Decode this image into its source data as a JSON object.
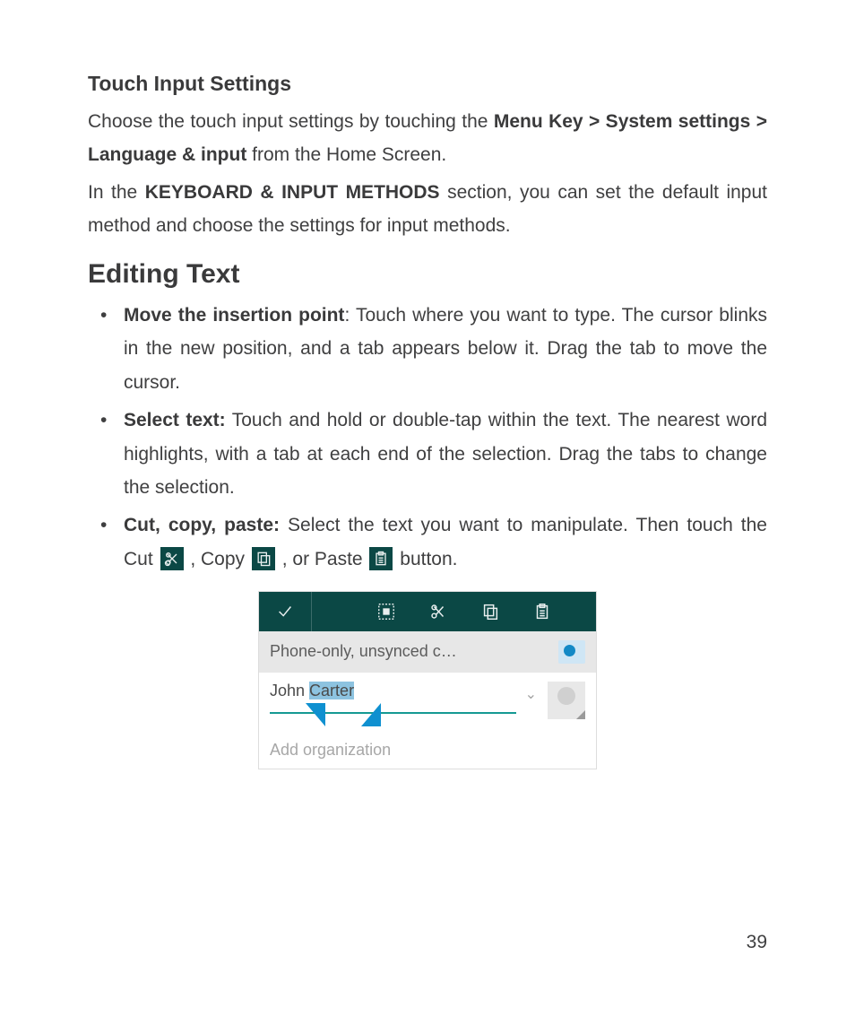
{
  "section1": {
    "heading": "Touch Input Settings",
    "p1a": "Choose the touch input settings by touching the ",
    "p1b": "Menu Key > System settings > Language & input",
    "p1c": " from the Home Screen.",
    "p2a": "In the ",
    "p2b": "KEYBOARD & INPUT METHODS",
    "p2c": " section, you can set the default input method and choose the settings for input meth­ods."
  },
  "section2": {
    "heading": "Editing Text",
    "b1_label": "Move the insertion point",
    "b1_text": ": Touch where you want to type. The cursor blinks in the new position, and a tab appears be­low it. Drag the tab to move the cursor.",
    "b2_label": "Select text:",
    "b2_text": " Touch and hold or double-tap within the text. The nearest word highlights, with a tab at each end of the selec­tion. Drag the tabs to change the selection.",
    "b3_label": "Cut, copy, paste:",
    "b3_text_a": " Select the text you want to manipulate. Then touch the Cut ",
    "b3_text_b": " , Copy ",
    "b3_text_c": " , or Paste ",
    "b3_text_d": " button."
  },
  "screenshot": {
    "row2_label": "Phone-only, unsynced c…",
    "name_pre": "John ",
    "name_selected": "Carter",
    "chevron": "⌄",
    "add_org": "Add organization"
  },
  "page_number": "39"
}
